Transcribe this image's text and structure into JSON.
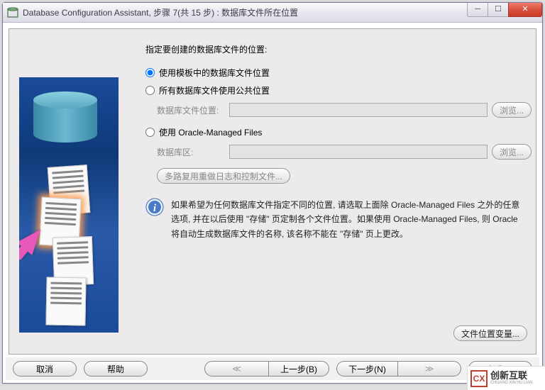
{
  "window": {
    "title": "Database Configuration Assistant, 步骤 7(共 15 步) : 数据库文件所在位置"
  },
  "form": {
    "instruction": "指定要创建的数据库文件的位置:",
    "option1": {
      "label": "使用模板中的数据库文件位置"
    },
    "option2": {
      "label": "所有数据库文件使用公共位置",
      "field_label": "数据库文件位置:",
      "field_value": "",
      "browse": "浏览..."
    },
    "option3": {
      "label": "使用 Oracle-Managed Files",
      "field_label": "数据库区:",
      "field_value": "",
      "browse": "浏览..."
    },
    "multiplex_btn": "多路复用重做日志和控制文件...",
    "info_text": "如果希望为任何数据库文件指定不同的位置, 请选取上面除 Oracle-Managed Files 之外的任意选项, 并在以后使用 \"存储\" 页定制各个文件位置。如果使用 Oracle-Managed Files, 则 Oracle 将自动生成数据库文件的名称, 该名称不能在 \"存储\" 页上更改。",
    "vars_btn": "文件位置变量..."
  },
  "buttons": {
    "cancel": "取消",
    "help": "帮助",
    "back": "上一步(B)",
    "next": "下一步(N)",
    "finish": "完成(E)"
  },
  "watermark": {
    "zh": "创新互联",
    "en": "CHUANG XIN HU LIAN"
  }
}
